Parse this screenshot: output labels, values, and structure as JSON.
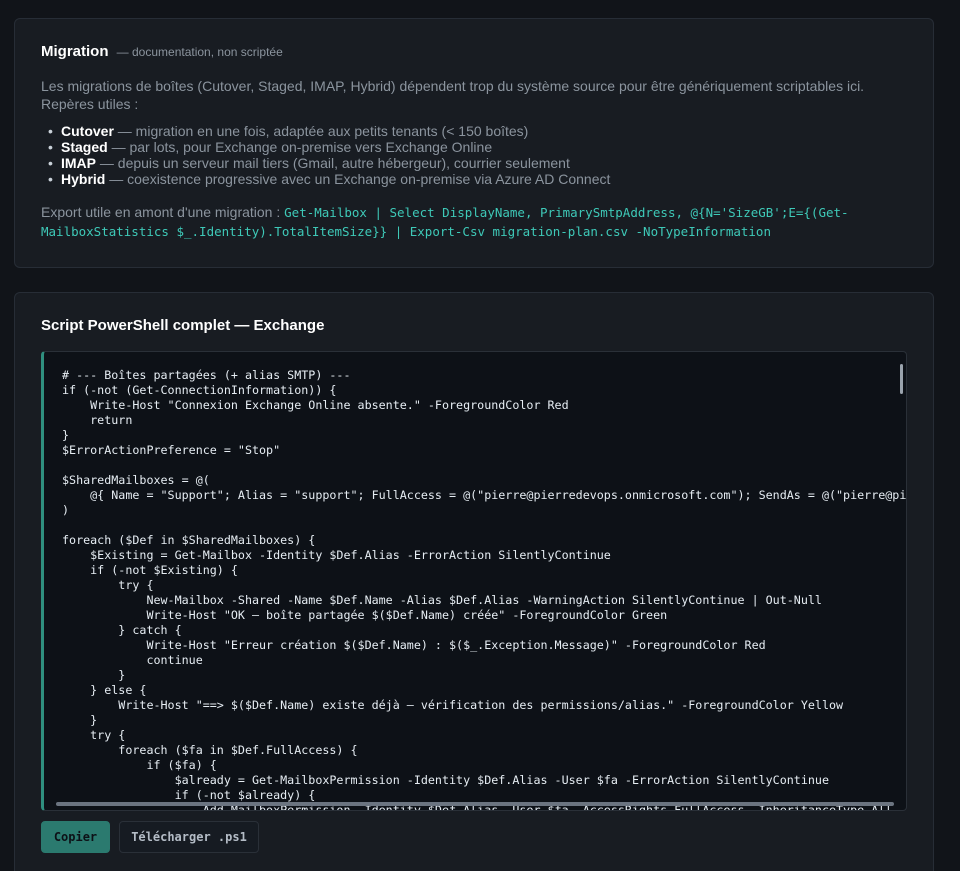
{
  "migration": {
    "title": "Migration",
    "subtitle": "— documentation, non scriptée",
    "intro": "Les migrations de boîtes (Cutover, Staged, IMAP, Hybrid) dépendent trop du système source pour être génériquement scriptables ici. Repères utiles :",
    "methods": [
      {
        "name": "Cutover",
        "desc": " — migration en une fois, adaptée aux petits tenants (< 150 boîtes)"
      },
      {
        "name": "Staged",
        "desc": " — par lots, pour Exchange on-premise vers Exchange Online"
      },
      {
        "name": "IMAP",
        "desc": " — depuis un serveur mail tiers (Gmail, autre hébergeur), courrier seulement"
      },
      {
        "name": "Hybrid",
        "desc": " — coexistence progressive avec un Exchange on-premise via Azure AD Connect"
      }
    ],
    "export_label": "Export utile en amont d'une migration : ",
    "export_command": "Get-Mailbox | Select DisplayName, PrimarySmtpAddress, @{N='SizeGB';E={(Get-MailboxStatistics $_.Identity).TotalItemSize}} | Export-Csv migration-plan.csv -NoTypeInformation"
  },
  "script": {
    "title": "Script PowerShell complet — Exchange",
    "code": "# --- Boîtes partagées (+ alias SMTP) ---\nif (-not (Get-ConnectionInformation)) {\n    Write-Host \"Connexion Exchange Online absente.\" -ForegroundColor Red\n    return\n}\n$ErrorActionPreference = \"Stop\"\n\n$SharedMailboxes = @(\n    @{ Name = \"Support\"; Alias = \"support\"; FullAccess = @(\"pierre@pierredevops.onmicrosoft.com\"); SendAs = @(\"pierre@pierredevops.onmicrosoft.com\") }\n)\n\nforeach ($Def in $SharedMailboxes) {\n    $Existing = Get-Mailbox -Identity $Def.Alias -ErrorAction SilentlyContinue\n    if (-not $Existing) {\n        try {\n            New-Mailbox -Shared -Name $Def.Name -Alias $Def.Alias -WarningAction SilentlyContinue | Out-Null\n            Write-Host \"OK — boîte partagée $($Def.Name) créée\" -ForegroundColor Green\n        } catch {\n            Write-Host \"Erreur création $($Def.Name) : $($_.Exception.Message)\" -ForegroundColor Red\n            continue\n        }\n    } else {\n        Write-Host \"==> $($Def.Name) existe déjà — vérification des permissions/alias.\" -ForegroundColor Yellow\n    }\n    try {\n        foreach ($fa in $Def.FullAccess) {\n            if ($fa) {\n                $already = Get-MailboxPermission -Identity $Def.Alias -User $fa -ErrorAction SilentlyContinue\n                if (-not $already) {\n                    Add-MailboxPermission -Identity $Def.Alias -User $fa -AccessRights FullAccess -InheritanceType All -AutoMapping $true | Out-Null"
  },
  "buttons": {
    "copy": "Copier",
    "download": "Télécharger .ps1"
  }
}
